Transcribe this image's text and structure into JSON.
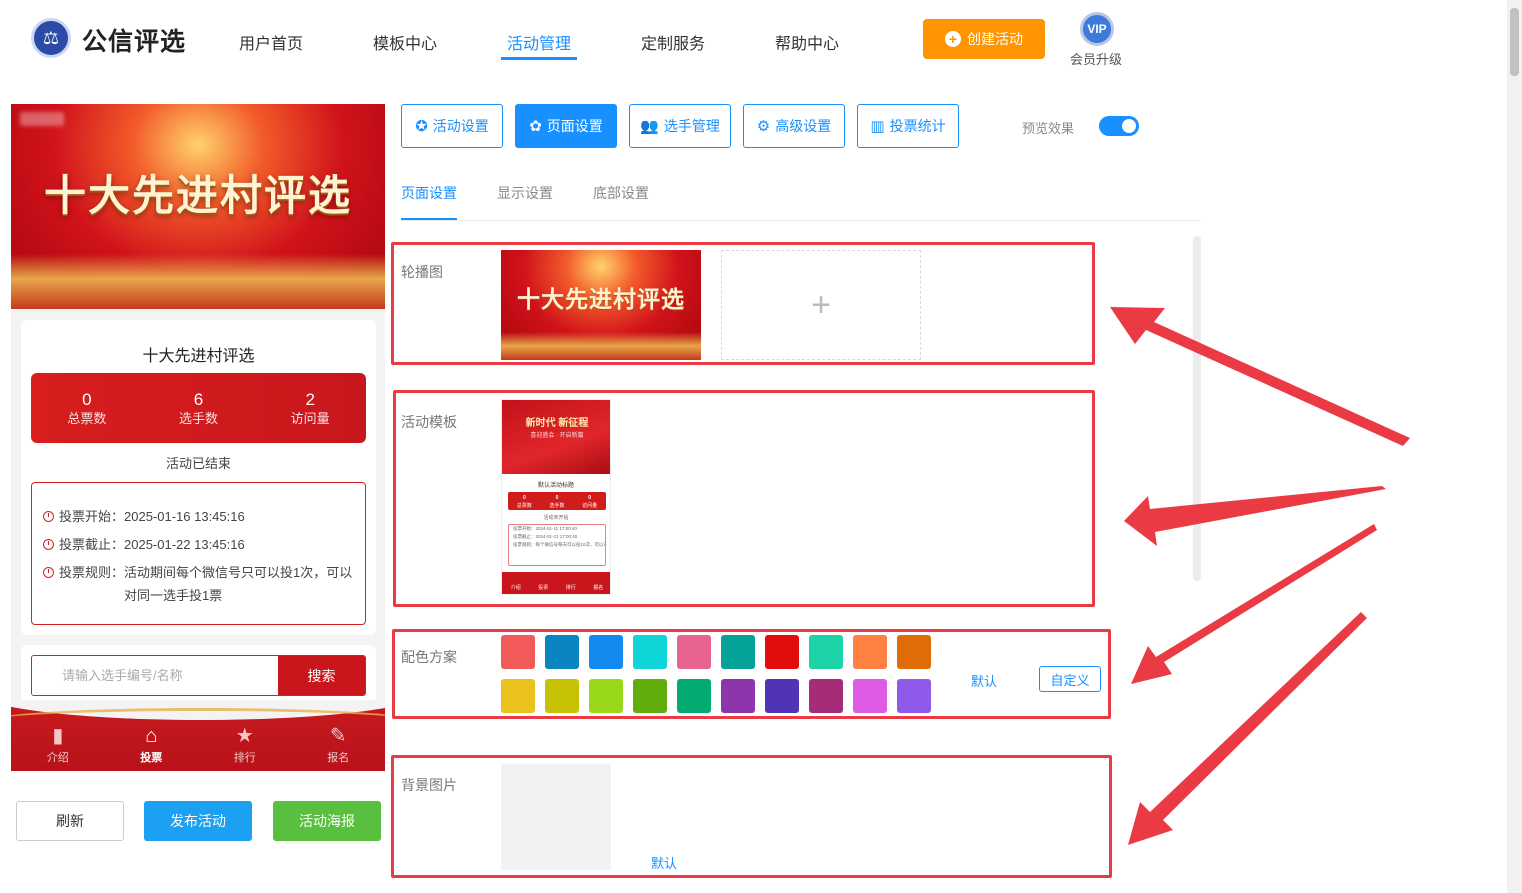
{
  "header": {
    "brand": "公信评选",
    "nav": [
      "用户首页",
      "模板中心",
      "活动管理",
      "定制服务",
      "帮助中心"
    ],
    "create_label": "创建活动",
    "vip_badge": "VIP",
    "vip_label": "会员升级"
  },
  "preview": {
    "banner_title": "十大先进村评选",
    "activity_title": "十大先进村评选",
    "stats": [
      {
        "num": "0",
        "label": "总票数"
      },
      {
        "num": "6",
        "label": "选手数"
      },
      {
        "num": "2",
        "label": "访问量"
      }
    ],
    "status": "活动已结束",
    "rules": {
      "start": "投票开始：2025-01-16 13:45:16",
      "end": "投票截止：2025-01-22 13:45:16",
      "rule_line1": "投票规则：活动期间每个微信号只可以投1次，可以",
      "rule_line2": "对同一选手投1票"
    },
    "search": {
      "placeholder": "请输入选手编号/名称",
      "button": "搜索"
    },
    "bottom_nav": [
      "介绍",
      "投票",
      "排行",
      "报名"
    ],
    "buttons": {
      "refresh": "刷新",
      "publish": "发布活动",
      "poster": "活动海报"
    }
  },
  "toolbar": {
    "tabs": [
      "活动设置",
      "页面设置",
      "选手管理",
      "高级设置",
      "投票统计"
    ],
    "preview_label": "预览效果"
  },
  "subtabs": [
    "页面设置",
    "显示设置",
    "底部设置"
  ],
  "sections": {
    "carousel": {
      "label": "轮播图",
      "image_title": "十大先进村评选",
      "add_symbol": "+"
    },
    "template": {
      "label": "活动模板",
      "thumb_title": "新时代 新征程",
      "thumb_sub": "喜迎盛会 · 开启新篇",
      "thumb_activity": "默认活动标题",
      "thumb_stats": [
        {
          "num": "0",
          "label": "总票数"
        },
        {
          "num": "0",
          "label": "选手数"
        },
        {
          "num": "0",
          "label": "访问量"
        }
      ],
      "thumb_status": "活动未开始",
      "thumb_rules": [
        "投票开始：2024-01-11 17:00:40",
        "投票截止：2024-01-21 17:00:40",
        "投票规则：每个微信号每天可以投10次，可以对同一选手投1票"
      ],
      "thumb_nav": [
        "介绍",
        "投票",
        "排行",
        "报名"
      ]
    },
    "colors": {
      "label": "配色方案",
      "row1": [
        "#f25a5a",
        "#0b85c0",
        "#1489f0",
        "#10d5d8",
        "#e7638f",
        "#05a298",
        "#e30c0c",
        "#1cd4a7",
        "#ff8040",
        "#e06c06"
      ],
      "row2": [
        "#ebc21b",
        "#c8c206",
        "#99d91a",
        "#62ad0e",
        "#04ab71",
        "#8f35ac",
        "#5134b6",
        "#a62c77",
        "#e05be3",
        "#8f5ae9"
      ],
      "default_link": "默认",
      "custom_button": "自定义"
    },
    "background": {
      "label": "背景图片",
      "default_link": "默认"
    }
  },
  "colors_theme": {
    "accent": "#1890ff",
    "highlight": "#ea3a43",
    "primary_red": "#c8161c",
    "orange": "#ff9500"
  }
}
